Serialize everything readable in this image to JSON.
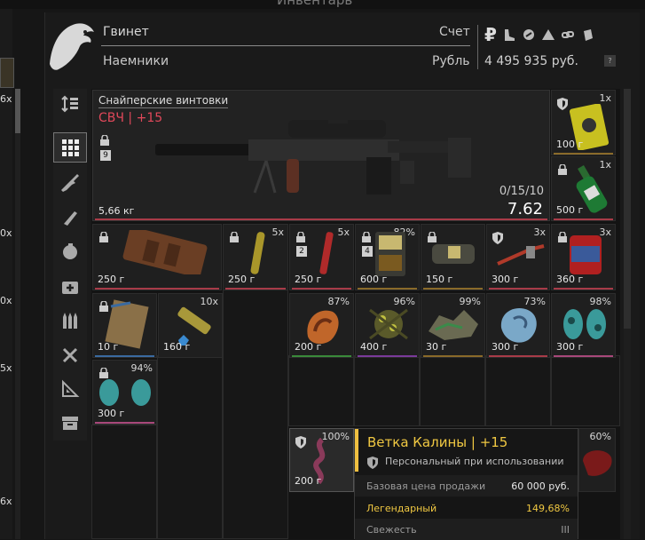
{
  "window": {
    "title": "Инвентарь"
  },
  "left_panel": {
    "counts": [
      "6x",
      "0x",
      "0x",
      "5x",
      "6x"
    ]
  },
  "trader": {
    "name": "Гвинет",
    "faction": "Наемники",
    "account_label": "Счет",
    "currency_label": "Рубль",
    "balance": "4 495 935 руб.",
    "help": "?"
  },
  "currency_icons": [
    "ruble-icon",
    "boot-icon",
    "coin-icon",
    "pyramid-icon",
    "chain-icon",
    "bag-icon"
  ],
  "currency_glyph": "₽",
  "nav": {
    "items": [
      "sort-icon",
      "grid-icon",
      "rifle-icon",
      "knife-icon",
      "grenade-icon",
      "medkit-icon",
      "ammo-icon",
      "tools-icon",
      "triangle-icon",
      "box-icon"
    ]
  },
  "weapon": {
    "category": "Снайперские винтовки",
    "name": "СВЧ | +15",
    "badge": "9",
    "weight": "5,66 кг",
    "ammo": "0/15/10",
    "caliber": "7.62"
  },
  "side_items": [
    {
      "count": "1x",
      "weight": "100 г"
    },
    {
      "count": "1x",
      "weight": "500 г"
    }
  ],
  "row1": [
    {
      "weight": "250 г",
      "count": ""
    },
    {
      "weight": "250 г",
      "count": "5x"
    },
    {
      "weight": "250 г",
      "count": "5x",
      "badge": "2"
    },
    {
      "weight": "600 г",
      "count": "82%",
      "badge": "4"
    },
    {
      "weight": "150 г",
      "count": ""
    },
    {
      "weight": "300 г",
      "count": "3x"
    },
    {
      "weight": "360 г",
      "count": "3x"
    }
  ],
  "row2": [
    {
      "weight": "10 г",
      "count": ""
    },
    {
      "weight": "160 г",
      "count": "10x"
    },
    {
      "weight": "200 г",
      "count": "87%"
    },
    {
      "weight": "400 г",
      "count": "96%"
    },
    {
      "weight": "30 г",
      "count": "99%"
    },
    {
      "weight": "300 г",
      "count": "73%"
    },
    {
      "weight": "300 г",
      "count": "98%"
    }
  ],
  "row3": [
    {
      "weight": "300 г",
      "count": "94%"
    }
  ],
  "hovered": {
    "weight": "200 г",
    "count": "100%"
  },
  "right_item": {
    "count": "60%"
  },
  "tooltip": {
    "title": "Ветка Калины | +15",
    "subtitle": "Персональный при использовании",
    "base_price_label": "Базовая цена продажи",
    "base_price": "60 000 руб.",
    "rarity_label": "Легендарный",
    "rarity_value": "149,68%",
    "freshness_label": "Свежесть",
    "freshness_value": "III"
  },
  "colors": {
    "accent": "#f0c842",
    "weapon_name": "#e0485a",
    "rarity": "#f0c842"
  }
}
